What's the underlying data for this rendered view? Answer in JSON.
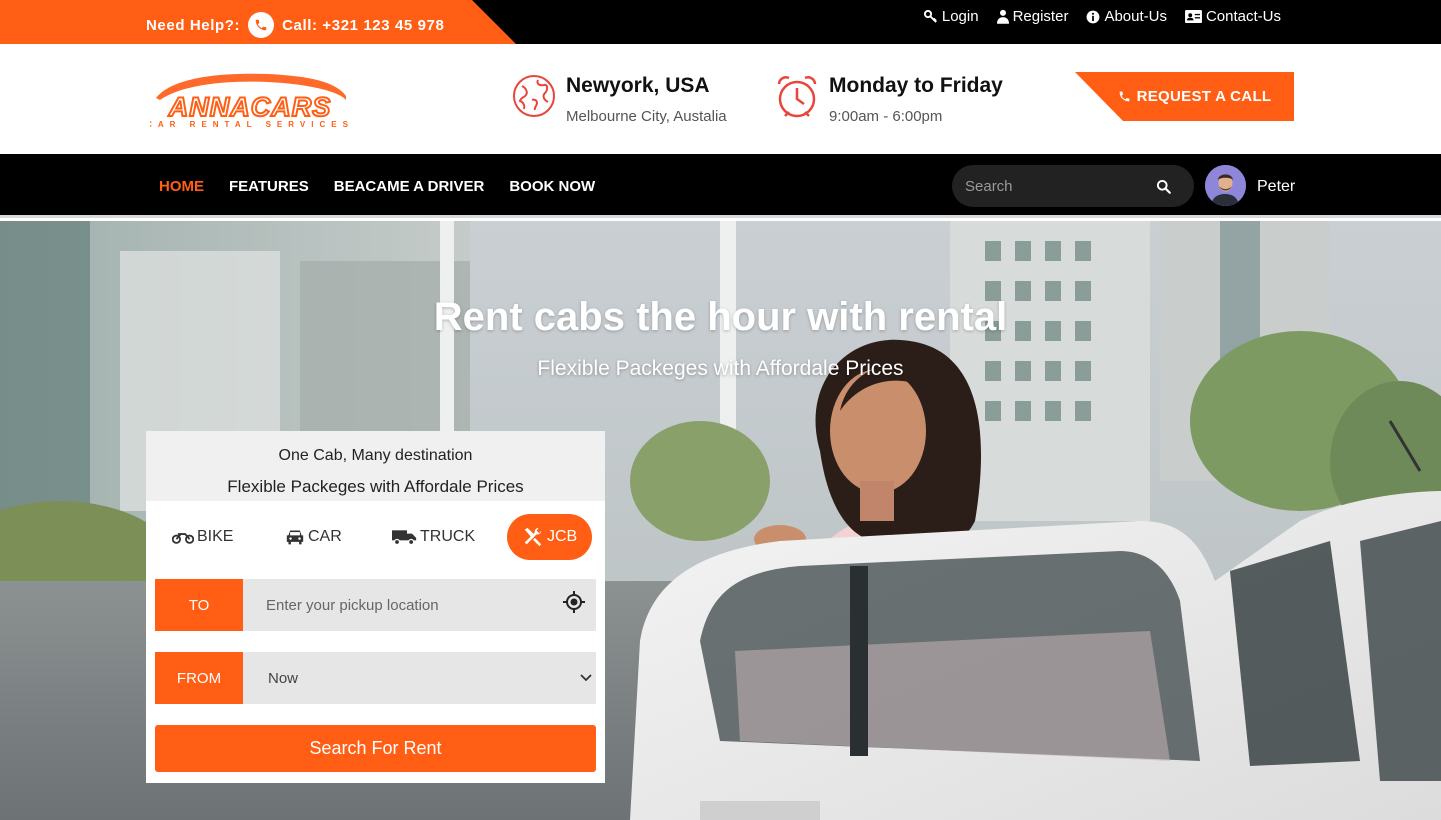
{
  "topbar": {
    "help_label": "Need Help?:",
    "call_label": "Call: +321 123 45 978",
    "links": [
      {
        "label": "Login",
        "icon": "key-icon"
      },
      {
        "label": "Register",
        "icon": "user-icon"
      },
      {
        "label": "About-Us",
        "icon": "info-icon"
      },
      {
        "label": "Contact-Us",
        "icon": "id-card-icon"
      }
    ]
  },
  "header": {
    "logo_text": "ANNACARS",
    "logo_tagline": "CAR RENTAL SERVICES",
    "location_title": "Newyork, USA",
    "location_sub": "Melbourne City, Austalia",
    "hours_title": "Monday to Friday",
    "hours_sub": "9:00am - 6:00pm",
    "request_button": "REQUEST A CALL"
  },
  "nav": {
    "items": [
      "HOME",
      "FEATURES",
      "BEACAME A DRIVER",
      "BOOK NOW"
    ],
    "active": "HOME",
    "search_placeholder": "Search",
    "user_name": "Peter"
  },
  "hero": {
    "title": "Rent cabs the hour with rental",
    "subtitle": "Flexible Packeges with Affordale Prices"
  },
  "booking": {
    "line1": "One Cab, Many destination",
    "line2": "Flexible Packeges with Affordale Prices",
    "types": [
      "BIKE",
      "CAR",
      "TRUCK",
      "JCB"
    ],
    "active_type": "JCB",
    "to_label": "TO",
    "to_placeholder": "Enter your pickup location",
    "from_label": "FROM",
    "from_value": "Now",
    "submit": "Search For Rent"
  },
  "colors": {
    "accent": "#ff5e14",
    "dark": "#000000"
  }
}
